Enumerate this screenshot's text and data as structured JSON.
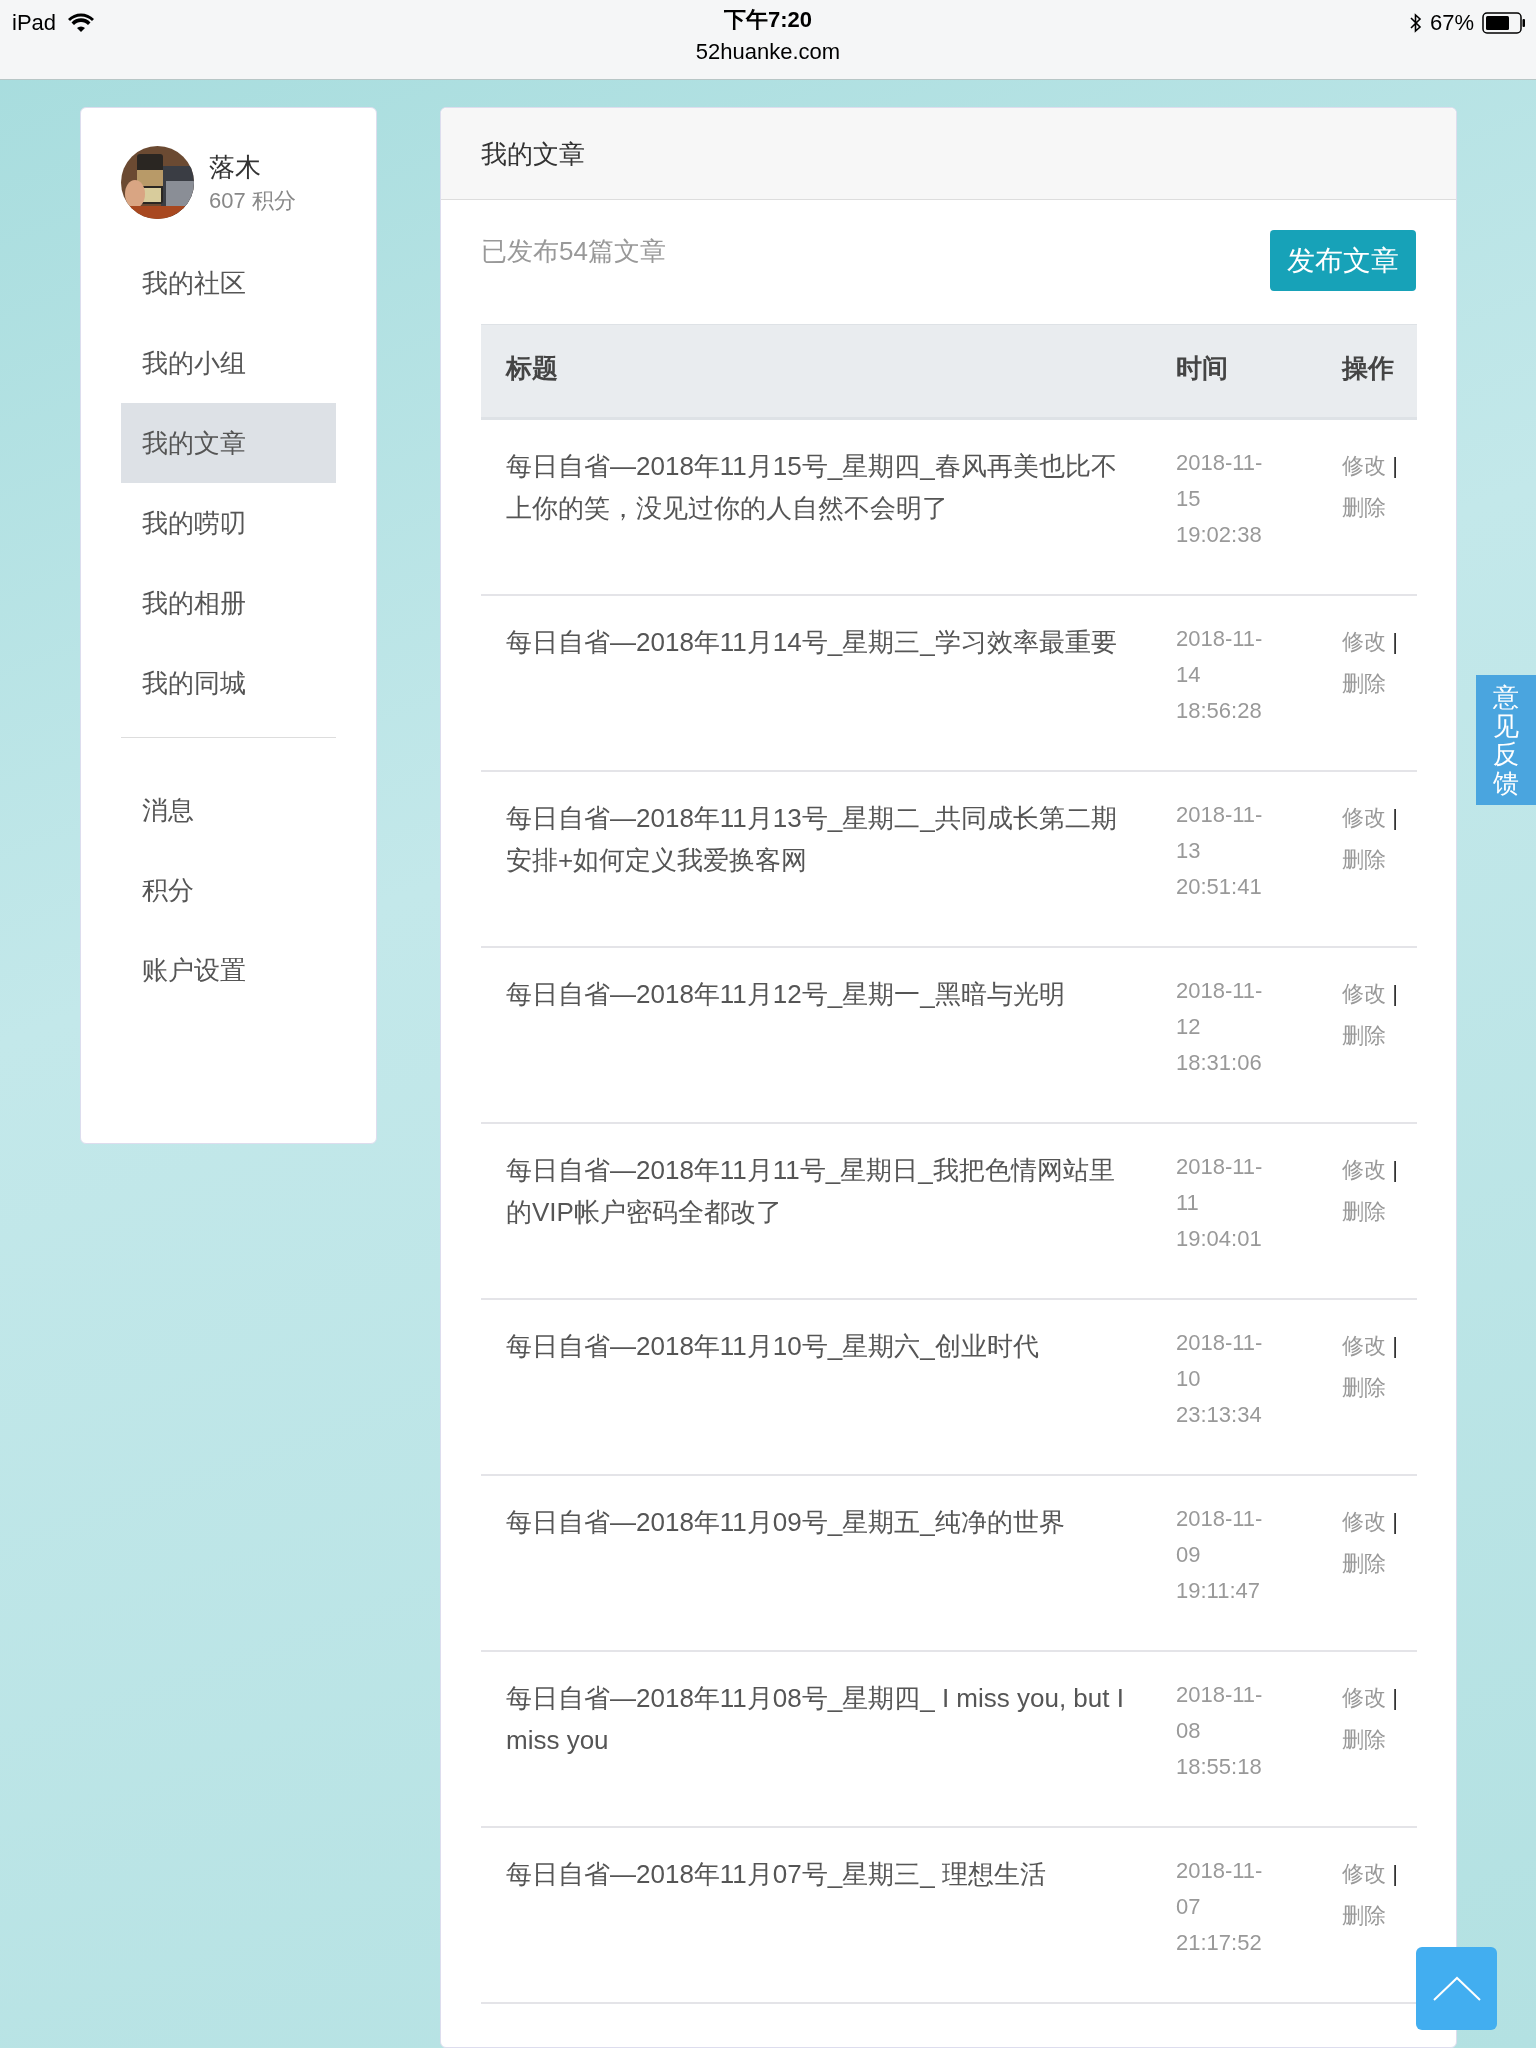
{
  "status_bar": {
    "device": "iPad",
    "time": "下午7:20",
    "url": "52huanke.com",
    "battery": "67%"
  },
  "profile": {
    "name": "落木",
    "points": "607 积分"
  },
  "sidebar": {
    "groups": [
      [
        {
          "label": "我的社区",
          "selected": false
        },
        {
          "label": "我的小组",
          "selected": false
        },
        {
          "label": "我的文章",
          "selected": true
        },
        {
          "label": "我的唠叨",
          "selected": false
        },
        {
          "label": "我的相册",
          "selected": false
        },
        {
          "label": "我的同城",
          "selected": false
        }
      ],
      [
        {
          "label": "消息",
          "selected": false
        },
        {
          "label": "积分",
          "selected": false
        },
        {
          "label": "账户设置",
          "selected": false
        }
      ]
    ]
  },
  "main": {
    "title": "我的文章",
    "summary": "已发布54篇文章",
    "publish_button": "发布文章"
  },
  "table": {
    "columns": [
      "标题",
      "时间",
      "操作"
    ],
    "rows": [
      {
        "title": "每日自省—2018年11月15号_星期四_春风再美也比不上你的笑，没见过你的人自然不会明了",
        "time": "2018-11-15 19:02:38",
        "edit": "修改",
        "separator": "|",
        "delete": "删除"
      },
      {
        "title": "每日自省—2018年11月14号_星期三_学习效率最重要",
        "time": "2018-11-14 18:56:28",
        "edit": "修改",
        "separator": "|",
        "delete": "删除"
      },
      {
        "title": "每日自省—2018年11月13号_星期二_共同成长第二期安排+如何定义我爱换客网",
        "time": "2018-11-13 20:51:41",
        "edit": "修改",
        "separator": "|",
        "delete": "删除"
      },
      {
        "title": "每日自省—2018年11月12号_星期一_黑暗与光明",
        "time": "2018-11-12 18:31:06",
        "edit": "修改",
        "separator": "|",
        "delete": "删除"
      },
      {
        "title": "每日自省—2018年11月11号_星期日_我把色情网站里的VIP帐户密码全都改了",
        "time": "2018-11-11 19:04:01",
        "edit": "修改",
        "separator": "|",
        "delete": "删除"
      },
      {
        "title": "每日自省—2018年11月10号_星期六_创业时代",
        "time": "2018-11-10 23:13:34",
        "edit": "修改",
        "separator": "|",
        "delete": "删除"
      },
      {
        "title": "每日自省—2018年11月09号_星期五_纯净的世界",
        "time": "2018-11-09 19:11:47",
        "edit": "修改",
        "separator": "|",
        "delete": "删除"
      },
      {
        "title": "每日自省—2018年11月08号_星期四_ I miss you, but I miss you",
        "time": "2018-11-08 18:55:18",
        "edit": "修改",
        "separator": "|",
        "delete": "删除"
      },
      {
        "title": "每日自省—2018年11月07号_星期三_ 理想生活",
        "time": "2018-11-07 21:17:52",
        "edit": "修改",
        "separator": "|",
        "delete": "删除"
      }
    ]
  },
  "feedback_tab": "意见反馈"
}
